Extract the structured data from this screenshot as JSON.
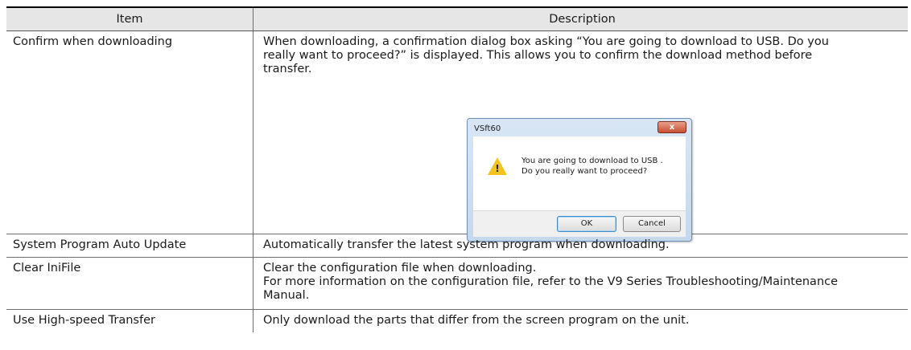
{
  "table": {
    "headers": [
      "Item",
      "Description"
    ],
    "rows": [
      {
        "item": "Confirm when downloading",
        "description_lines": [
          "When downloading, a confirmation dialog box asking “You are going to download to USB. Do you",
          "really want to proceed?” is displayed. This allows you to confirm the download method before",
          "transfer."
        ]
      },
      {
        "item": "System Program Auto Update",
        "description_lines": [
          "Automatically transfer the latest system program when downloading."
        ]
      },
      {
        "item": "Clear IniFile",
        "description_lines": [
          "Clear the configuration file when downloading.",
          "For more information on the configuration file, refer to the V9 Series Troubleshooting/Maintenance",
          "Manual."
        ]
      },
      {
        "item": "Use High-speed Transfer",
        "description_lines": [
          "Only download the parts that differ from the screen program on the unit."
        ]
      }
    ]
  },
  "dialog": {
    "title": "VSft60",
    "close_glyph": "x",
    "icon": "warning-icon",
    "message_lines": [
      "You are going to download to  USB  .",
      "Do you really want to proceed?"
    ],
    "ok_label": "OK",
    "cancel_label": "Cancel"
  }
}
